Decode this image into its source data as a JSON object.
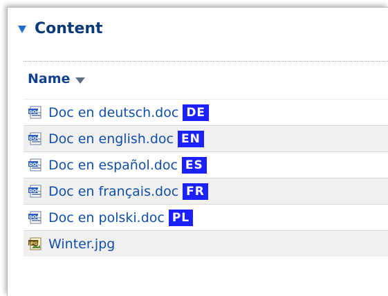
{
  "section": {
    "title": "Content",
    "icon": "triangle-down-icon",
    "accent": "#1f6fd6"
  },
  "columns": {
    "name_label": "Name",
    "sort_icon": "sort-desc-icon"
  },
  "files": [
    {
      "name": "Doc en deutsch.doc",
      "type": "doc",
      "icon": "doc-file-icon",
      "lang": "DE"
    },
    {
      "name": "Doc en english.doc",
      "type": "doc",
      "icon": "doc-file-icon",
      "lang": "EN"
    },
    {
      "name": "Doc en español.doc",
      "type": "doc",
      "icon": "doc-file-icon",
      "lang": "ES"
    },
    {
      "name": "Doc en français.doc",
      "type": "doc",
      "icon": "doc-file-icon",
      "lang": "FR"
    },
    {
      "name": "Doc en polski.doc",
      "type": "doc",
      "icon": "doc-file-icon",
      "lang": "PL"
    },
    {
      "name": "Winter.jpg",
      "type": "jpg",
      "icon": "jpg-file-icon",
      "lang": ""
    }
  ],
  "badge_color": "#1a20ff"
}
